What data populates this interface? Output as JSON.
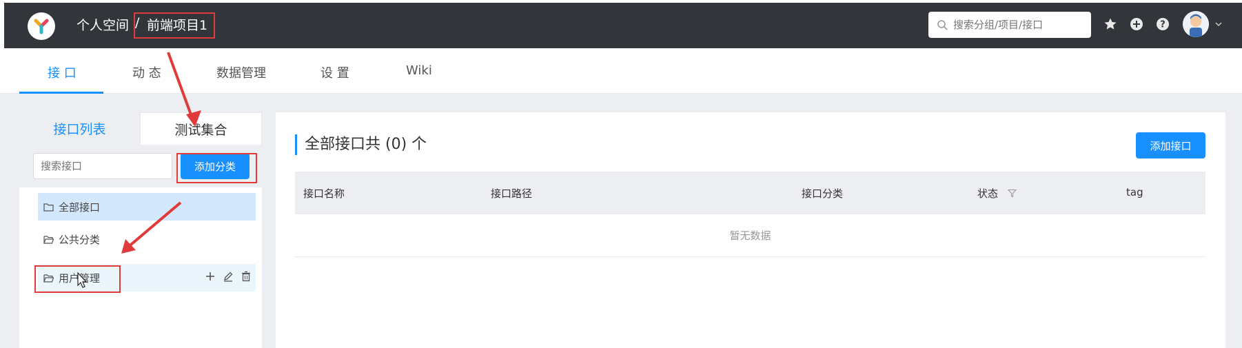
{
  "header": {
    "breadcrumb": {
      "personal": "个人空间",
      "separator": "/",
      "project": "前端项目1"
    },
    "search": {
      "placeholder": "搜索分组/项目/接口"
    },
    "icons": [
      "star-icon",
      "plus-circle-icon",
      "help-icon",
      "avatar",
      "chevron-down-icon"
    ]
  },
  "subnav": {
    "tabs": [
      {
        "label": "接 口",
        "active": true
      },
      {
        "label": "动 态"
      },
      {
        "label": "数据管理"
      },
      {
        "label": "设 置"
      },
      {
        "label": "Wiki"
      }
    ]
  },
  "left_panel": {
    "tabs": {
      "list": "接口列表",
      "collection": "测试集合"
    },
    "search_placeholder": "搜索接口",
    "add_category_label": "添加分类",
    "categories": [
      {
        "label": "全部接口",
        "selected": true
      },
      {
        "label": "公共分类"
      },
      {
        "label": "用户管理",
        "hovered": true
      }
    ]
  },
  "main": {
    "title": "全部接口共 (0) 个",
    "add_api_label": "添加接口",
    "table": {
      "columns": [
        "接口名称",
        "接口路径",
        "接口分类",
        "状态",
        "tag"
      ],
      "empty_text": "暂无数据"
    }
  },
  "colors": {
    "header_bg": "#32363a",
    "accent": "#1890ff",
    "annotation_red": "#e03a3a"
  }
}
